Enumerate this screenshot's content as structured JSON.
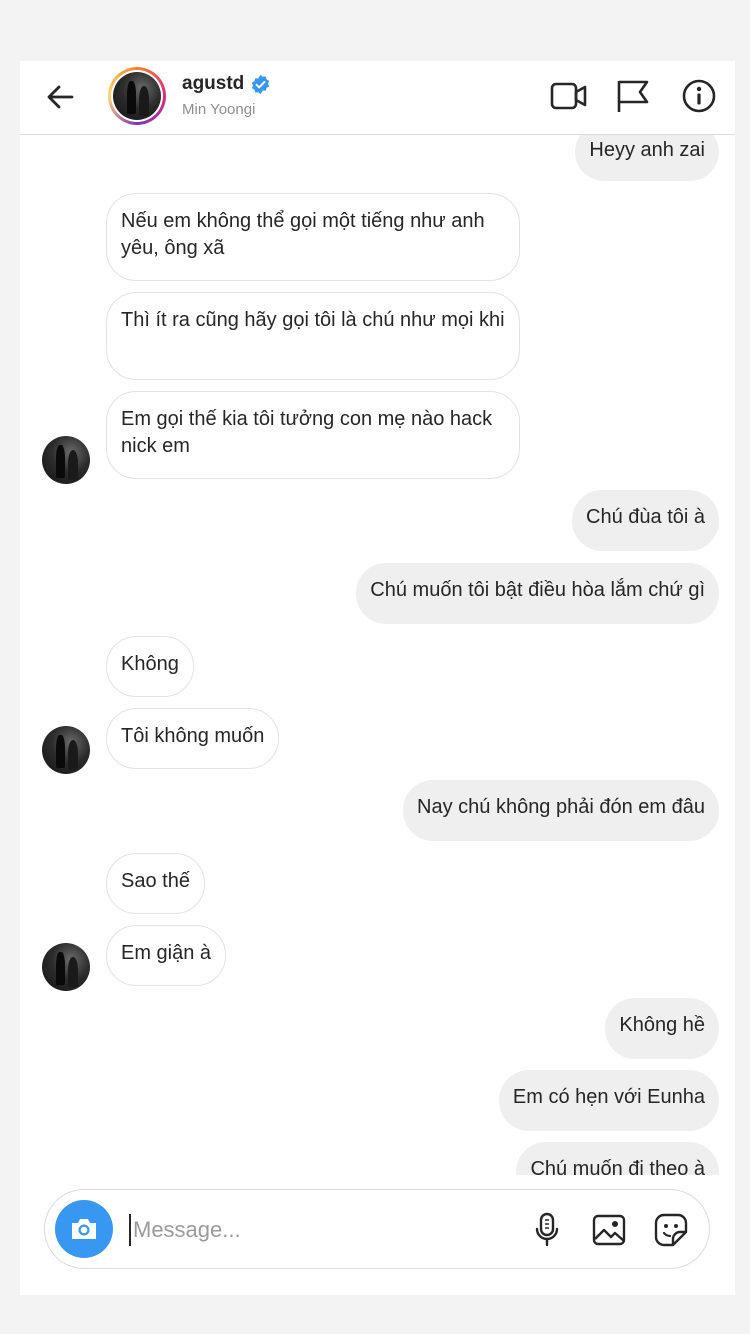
{
  "header": {
    "username": "agustd",
    "display_name": "Min Yoongi"
  },
  "messages": [
    {
      "side": "out",
      "text": "Heyy anh zai"
    },
    {
      "side": "in",
      "text": "Nếu em không thể gọi một tiếng như anh yêu, ông xã"
    },
    {
      "side": "in",
      "text": "Thì ít ra cũng hãy gọi tôi là chú như mọi khi"
    },
    {
      "side": "in",
      "text": "Em gọi thế kia tôi tưởng con mẹ nào hack nick em"
    },
    {
      "side": "out",
      "text": "Chú đùa tôi à"
    },
    {
      "side": "out",
      "text": "Chú muốn tôi bật điều hòa lắm chứ gì"
    },
    {
      "side": "in",
      "text": "Không"
    },
    {
      "side": "in",
      "text": "Tôi không muốn"
    },
    {
      "side": "out",
      "text": "Nay chú không phải đón em đâu"
    },
    {
      "side": "in",
      "text": "Sao thế"
    },
    {
      "side": "in",
      "text": "Em giận à"
    },
    {
      "side": "out",
      "text": "Không hề"
    },
    {
      "side": "out",
      "text": "Em có hẹn với Eunha"
    },
    {
      "side": "out",
      "text": "Chú muốn đi theo à"
    }
  ],
  "composer": {
    "placeholder": "Message..."
  },
  "colors": {
    "accent": "#3897f0",
    "verified": "#3897f0",
    "outgoing_bubble": "#efefef"
  },
  "icons": [
    "back-arrow-icon",
    "verified-badge-icon",
    "video-call-icon",
    "flag-icon",
    "info-icon",
    "camera-icon",
    "microphone-icon",
    "gallery-icon",
    "sticker-icon"
  ]
}
